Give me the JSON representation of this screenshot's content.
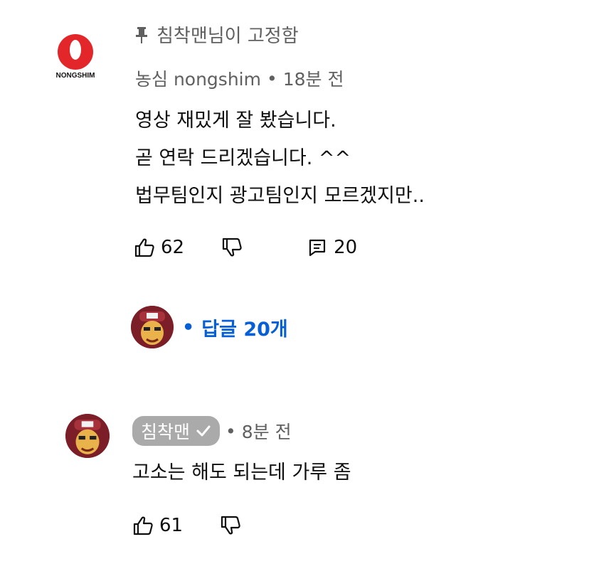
{
  "comment1": {
    "pinned_text": "침착맨님이 고정함",
    "logo_text": "NONGSHIM",
    "author": "농심 nongshim",
    "time": "18분 전",
    "lines": [
      "영상 재밌게 잘 봤습니다.",
      "곧 연락 드리겠습니다. ^^",
      "법무팀인지 광고팀인지 모르겠지만.."
    ],
    "likes": "62",
    "replies_count": "20"
  },
  "replies_link": {
    "label": "답글 20개"
  },
  "comment2": {
    "author": "침착맨",
    "time": "8분 전",
    "text": "고소는 해도 되는데 가루 좀",
    "likes": "61"
  },
  "icons": {
    "pin": "pin-icon",
    "like": "thumbs-up-icon",
    "dislike": "thumbs-down-icon",
    "reply": "reply-icon",
    "verified": "checkmark-icon"
  },
  "colors": {
    "link": "#065fd4",
    "meta": "#606060",
    "brand_red": "#e3262a"
  }
}
